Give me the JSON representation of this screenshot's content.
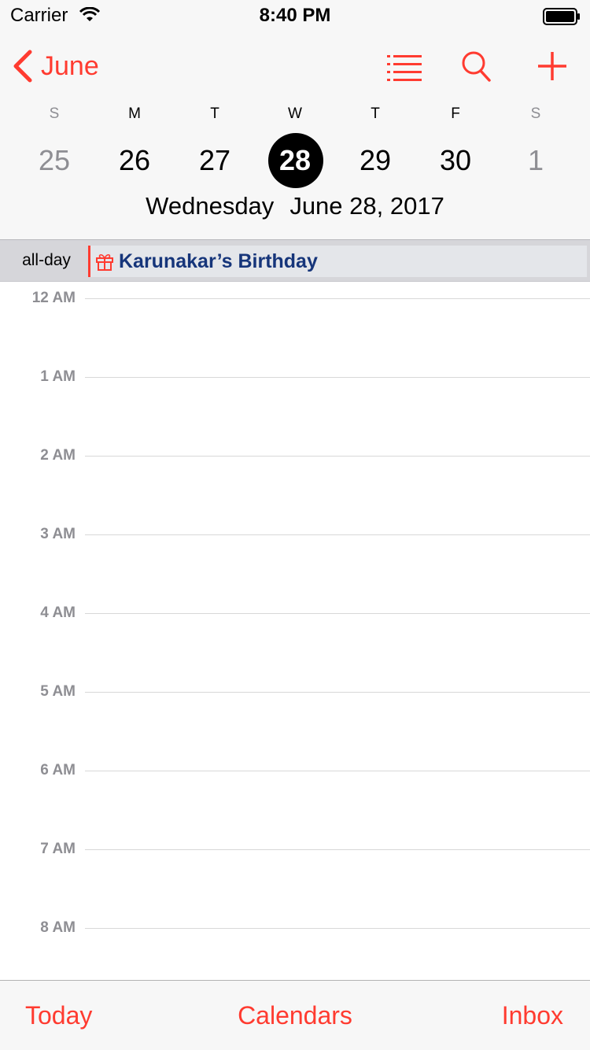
{
  "status_bar": {
    "carrier": "Carrier",
    "time": "8:40 PM"
  },
  "nav": {
    "back_label": "June",
    "icons": [
      "list-icon",
      "search-icon",
      "add-icon"
    ],
    "accent_color": "#ff3b30"
  },
  "week": {
    "weekday_letters": [
      "S",
      "M",
      "T",
      "W",
      "T",
      "F",
      "S"
    ],
    "days": [
      "25",
      "26",
      "27",
      "28",
      "29",
      "30",
      "1"
    ],
    "selected_index": 3,
    "muted_indices": [
      0,
      6
    ]
  },
  "selected_date": {
    "weekday": "Wednesday",
    "date": "June 28, 2017"
  },
  "all_day": {
    "label": "all-day",
    "event_title": "Karunakar’s Birthday",
    "event_icon": "gift-icon",
    "event_text_color": "#16357a"
  },
  "timeline": {
    "hours": [
      "12 AM",
      "1 AM",
      "2 AM",
      "3 AM",
      "4 AM",
      "5 AM",
      "6 AM",
      "7 AM",
      "8 AM"
    ]
  },
  "toolbar": {
    "today": "Today",
    "calendars": "Calendars",
    "inbox": "Inbox"
  }
}
